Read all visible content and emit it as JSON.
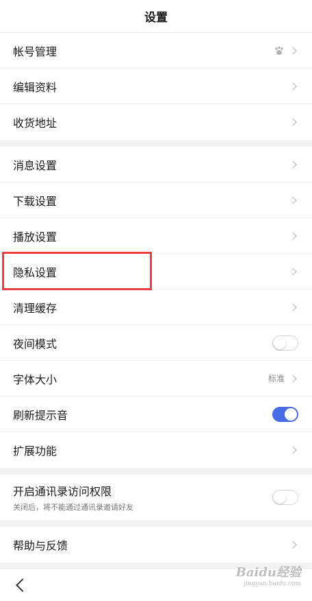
{
  "header": {
    "title": "设置"
  },
  "group1": [
    {
      "label": "帐号管理",
      "icon": "paw-icon"
    },
    {
      "label": "编辑资料"
    },
    {
      "label": "收货地址"
    }
  ],
  "group2": [
    {
      "label": "消息设置"
    },
    {
      "label": "下载设置"
    },
    {
      "label": "播放设置"
    },
    {
      "label": "隐私设置"
    },
    {
      "label": "清理缓存"
    },
    {
      "label": "夜间模式",
      "toggle": "off"
    },
    {
      "label": "字体大小",
      "value": "标准"
    },
    {
      "label": "刷新提示音",
      "toggle": "on"
    },
    {
      "label": "扩展功能"
    }
  ],
  "group3": {
    "label": "开启通讯录访问权限",
    "sub": "关闭后，将不能通过通讯录邀请好友",
    "toggle": "off"
  },
  "group4": [
    {
      "label": "帮助与反馈"
    }
  ],
  "watermark": {
    "main": "Baidu经验",
    "url": "jingyan.baidu.com"
  },
  "colors": {
    "accent": "#4a6be8",
    "highlight": "#e8413d"
  }
}
